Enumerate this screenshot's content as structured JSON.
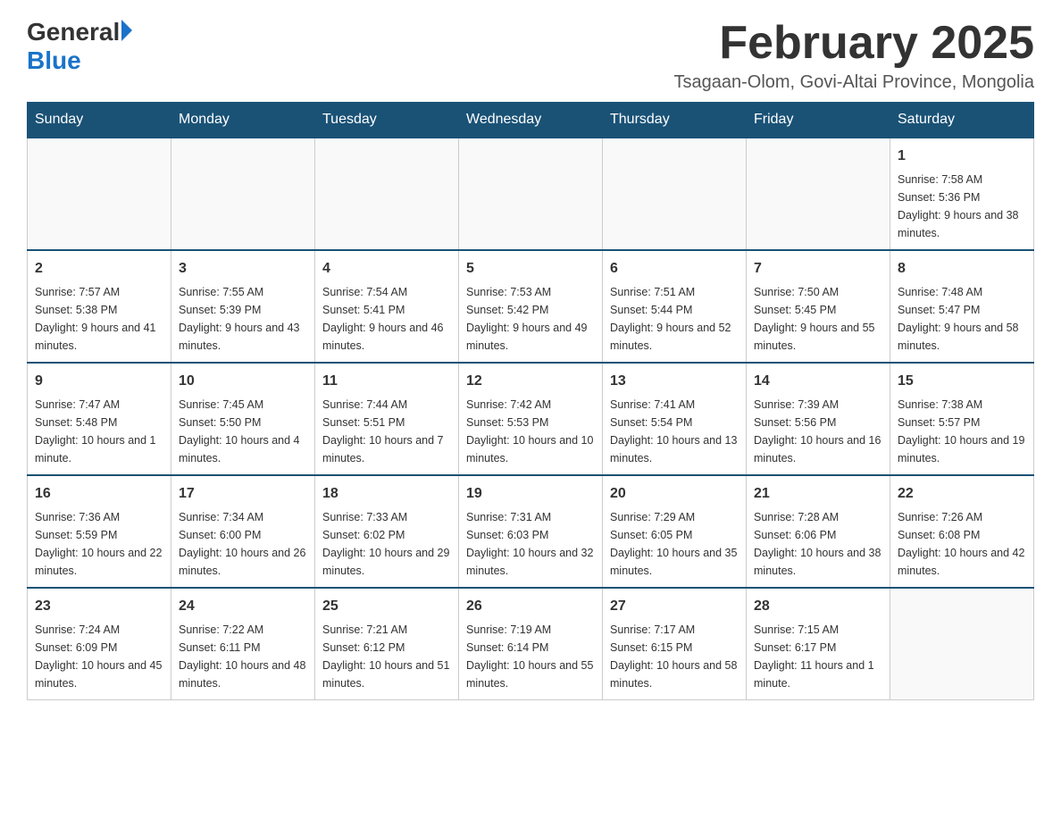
{
  "logo": {
    "general": "General",
    "blue": "Blue"
  },
  "title": "February 2025",
  "location": "Tsagaan-Olom, Govi-Altai Province, Mongolia",
  "days_of_week": [
    "Sunday",
    "Monday",
    "Tuesday",
    "Wednesday",
    "Thursday",
    "Friday",
    "Saturday"
  ],
  "weeks": [
    [
      {
        "day": "",
        "info": ""
      },
      {
        "day": "",
        "info": ""
      },
      {
        "day": "",
        "info": ""
      },
      {
        "day": "",
        "info": ""
      },
      {
        "day": "",
        "info": ""
      },
      {
        "day": "",
        "info": ""
      },
      {
        "day": "1",
        "info": "Sunrise: 7:58 AM\nSunset: 5:36 PM\nDaylight: 9 hours and 38 minutes."
      }
    ],
    [
      {
        "day": "2",
        "info": "Sunrise: 7:57 AM\nSunset: 5:38 PM\nDaylight: 9 hours and 41 minutes."
      },
      {
        "day": "3",
        "info": "Sunrise: 7:55 AM\nSunset: 5:39 PM\nDaylight: 9 hours and 43 minutes."
      },
      {
        "day": "4",
        "info": "Sunrise: 7:54 AM\nSunset: 5:41 PM\nDaylight: 9 hours and 46 minutes."
      },
      {
        "day": "5",
        "info": "Sunrise: 7:53 AM\nSunset: 5:42 PM\nDaylight: 9 hours and 49 minutes."
      },
      {
        "day": "6",
        "info": "Sunrise: 7:51 AM\nSunset: 5:44 PM\nDaylight: 9 hours and 52 minutes."
      },
      {
        "day": "7",
        "info": "Sunrise: 7:50 AM\nSunset: 5:45 PM\nDaylight: 9 hours and 55 minutes."
      },
      {
        "day": "8",
        "info": "Sunrise: 7:48 AM\nSunset: 5:47 PM\nDaylight: 9 hours and 58 minutes."
      }
    ],
    [
      {
        "day": "9",
        "info": "Sunrise: 7:47 AM\nSunset: 5:48 PM\nDaylight: 10 hours and 1 minute."
      },
      {
        "day": "10",
        "info": "Sunrise: 7:45 AM\nSunset: 5:50 PM\nDaylight: 10 hours and 4 minutes."
      },
      {
        "day": "11",
        "info": "Sunrise: 7:44 AM\nSunset: 5:51 PM\nDaylight: 10 hours and 7 minutes."
      },
      {
        "day": "12",
        "info": "Sunrise: 7:42 AM\nSunset: 5:53 PM\nDaylight: 10 hours and 10 minutes."
      },
      {
        "day": "13",
        "info": "Sunrise: 7:41 AM\nSunset: 5:54 PM\nDaylight: 10 hours and 13 minutes."
      },
      {
        "day": "14",
        "info": "Sunrise: 7:39 AM\nSunset: 5:56 PM\nDaylight: 10 hours and 16 minutes."
      },
      {
        "day": "15",
        "info": "Sunrise: 7:38 AM\nSunset: 5:57 PM\nDaylight: 10 hours and 19 minutes."
      }
    ],
    [
      {
        "day": "16",
        "info": "Sunrise: 7:36 AM\nSunset: 5:59 PM\nDaylight: 10 hours and 22 minutes."
      },
      {
        "day": "17",
        "info": "Sunrise: 7:34 AM\nSunset: 6:00 PM\nDaylight: 10 hours and 26 minutes."
      },
      {
        "day": "18",
        "info": "Sunrise: 7:33 AM\nSunset: 6:02 PM\nDaylight: 10 hours and 29 minutes."
      },
      {
        "day": "19",
        "info": "Sunrise: 7:31 AM\nSunset: 6:03 PM\nDaylight: 10 hours and 32 minutes."
      },
      {
        "day": "20",
        "info": "Sunrise: 7:29 AM\nSunset: 6:05 PM\nDaylight: 10 hours and 35 minutes."
      },
      {
        "day": "21",
        "info": "Sunrise: 7:28 AM\nSunset: 6:06 PM\nDaylight: 10 hours and 38 minutes."
      },
      {
        "day": "22",
        "info": "Sunrise: 7:26 AM\nSunset: 6:08 PM\nDaylight: 10 hours and 42 minutes."
      }
    ],
    [
      {
        "day": "23",
        "info": "Sunrise: 7:24 AM\nSunset: 6:09 PM\nDaylight: 10 hours and 45 minutes."
      },
      {
        "day": "24",
        "info": "Sunrise: 7:22 AM\nSunset: 6:11 PM\nDaylight: 10 hours and 48 minutes."
      },
      {
        "day": "25",
        "info": "Sunrise: 7:21 AM\nSunset: 6:12 PM\nDaylight: 10 hours and 51 minutes."
      },
      {
        "day": "26",
        "info": "Sunrise: 7:19 AM\nSunset: 6:14 PM\nDaylight: 10 hours and 55 minutes."
      },
      {
        "day": "27",
        "info": "Sunrise: 7:17 AM\nSunset: 6:15 PM\nDaylight: 10 hours and 58 minutes."
      },
      {
        "day": "28",
        "info": "Sunrise: 7:15 AM\nSunset: 6:17 PM\nDaylight: 11 hours and 1 minute."
      },
      {
        "day": "",
        "info": ""
      }
    ]
  ],
  "colors": {
    "header_bg": "#1a5276",
    "header_text": "#ffffff",
    "border": "#cccccc",
    "text": "#333333"
  }
}
